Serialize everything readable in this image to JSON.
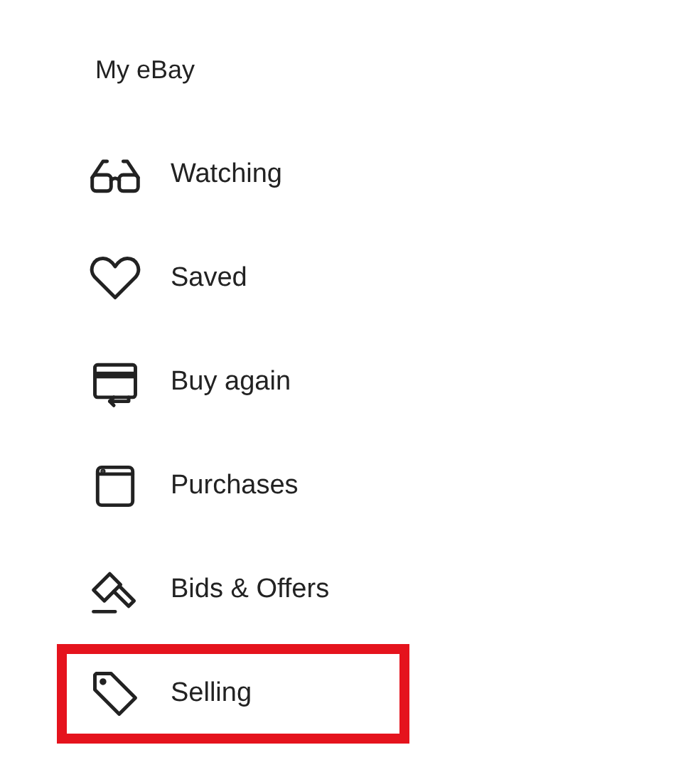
{
  "menu_title": "My eBay",
  "items": [
    {
      "label": "Watching",
      "kind": "glasses",
      "highlighted": false
    },
    {
      "label": "Saved",
      "kind": "heart",
      "highlighted": false
    },
    {
      "label": "Buy again",
      "kind": "card",
      "highlighted": false
    },
    {
      "label": "Purchases",
      "kind": "window",
      "highlighted": false
    },
    {
      "label": "Bids & Offers",
      "kind": "gavel",
      "highlighted": false
    },
    {
      "label": "Selling",
      "kind": "tag",
      "highlighted": true
    }
  ]
}
